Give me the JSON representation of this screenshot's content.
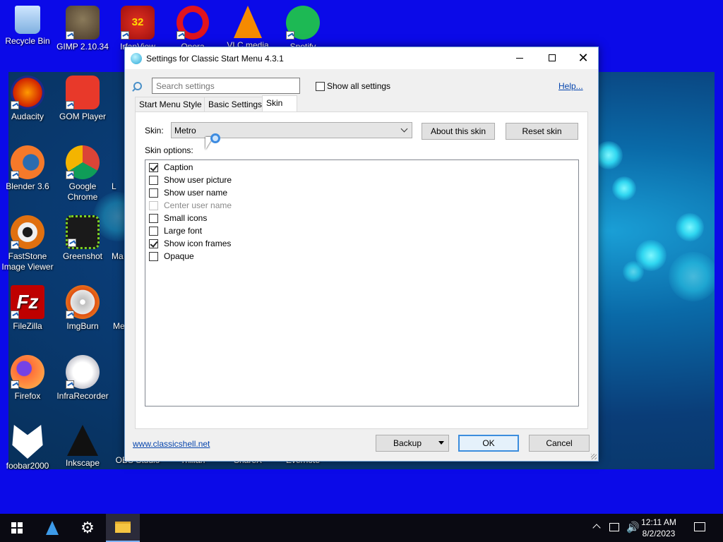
{
  "desktop": {
    "icons": [
      {
        "label": "Recycle Bin",
        "icon": "recycle-bin-icon"
      },
      {
        "label": "GIMP 2.10.34",
        "icon": "gimp-icon"
      },
      {
        "label": "IrfanView",
        "icon": "irfanview-icon",
        "badge": "32"
      },
      {
        "label": "Opera",
        "icon": "opera-icon"
      },
      {
        "label": "VLC media",
        "icon": "vlc-icon"
      },
      {
        "label": "Spotify",
        "icon": "spotify-icon"
      },
      {
        "label": "Audacity",
        "icon": "audacity-icon"
      },
      {
        "label": "GOM Player",
        "icon": "gom-player-icon"
      },
      {
        "label": "Blender 3.6",
        "icon": "blender-icon"
      },
      {
        "label": "Google Chrome",
        "icon": "chrome-icon"
      },
      {
        "label": "FastStone Image Viewer",
        "icon": "faststone-icon"
      },
      {
        "label": "Greenshot",
        "icon": "greenshot-icon"
      },
      {
        "label": "FileZilla",
        "icon": "filezilla-icon"
      },
      {
        "label": "ImgBurn",
        "icon": "imgburn-icon"
      },
      {
        "label": "Firefox",
        "icon": "firefox-icon"
      },
      {
        "label": "InfraRecorder",
        "icon": "infrarecorder-icon"
      },
      {
        "label": "foobar2000",
        "icon": "foobar2000-icon"
      },
      {
        "label": "Inkscape",
        "icon": "inkscape-icon"
      },
      {
        "label": "OBS Studio",
        "icon": "obs-icon"
      },
      {
        "label": "Trillian",
        "icon": "trillian-icon"
      },
      {
        "label": "ShareX",
        "icon": "sharex-icon"
      },
      {
        "label": "Evernote",
        "icon": "evernote-icon"
      }
    ],
    "partial_labels": [
      "L",
      "Ma",
      "Me"
    ]
  },
  "window": {
    "title": "Settings for Classic Start Menu 4.3.1",
    "search_placeholder": "Search settings",
    "show_all_label": "Show all settings",
    "help_link": "Help...",
    "tabs": [
      {
        "label": "Start Menu Style",
        "selected": false
      },
      {
        "label": "Basic Settings",
        "selected": false
      },
      {
        "label": "Skin",
        "selected": true
      }
    ],
    "skin_label": "Skin:",
    "skin_value": "Metro",
    "about_skin_button": "About this skin",
    "reset_skin_button": "Reset skin",
    "skin_options_label": "Skin options:",
    "options": [
      {
        "label": "Caption",
        "checked": true,
        "enabled": true
      },
      {
        "label": "Show user picture",
        "checked": false,
        "enabled": true
      },
      {
        "label": "Show user name",
        "checked": false,
        "enabled": true
      },
      {
        "label": "Center user name",
        "checked": false,
        "enabled": false
      },
      {
        "label": "Small icons",
        "checked": false,
        "enabled": true
      },
      {
        "label": "Large font",
        "checked": false,
        "enabled": true
      },
      {
        "label": "Show icon frames",
        "checked": true,
        "enabled": true
      },
      {
        "label": "Opaque",
        "checked": false,
        "enabled": true
      }
    ],
    "website_link": "www.classicshell.net",
    "backup_button": "Backup",
    "ok_button": "OK",
    "cancel_button": "Cancel"
  },
  "taskbar": {
    "time": "12:11 AM",
    "date": "8/2/2023"
  },
  "colors": {
    "desktop_bg": "#0b0ae8",
    "link": "#0645ad",
    "accent": "#3c8ddd"
  }
}
